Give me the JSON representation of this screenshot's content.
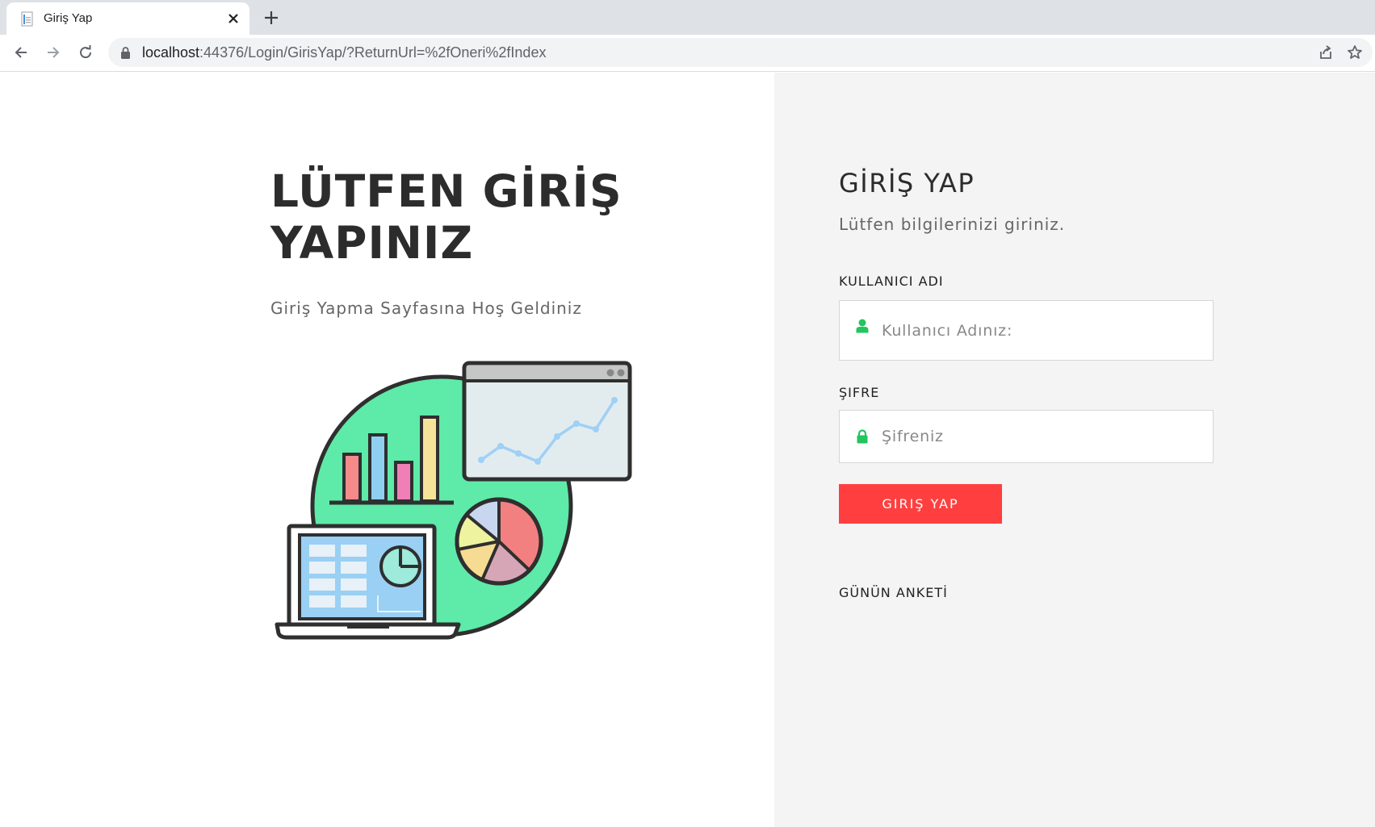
{
  "browser": {
    "tab_title": "Giriş Yap",
    "url_host": "localhost",
    "url_rest": ":44376/Login/GirisYap/?ReturnUrl=%2fOneri%2fIndex"
  },
  "icons": {
    "favicon": "document-icon",
    "tab_close": "close-icon",
    "new_tab": "plus-icon",
    "back": "arrow-left-icon",
    "forward": "arrow-right-icon",
    "reload": "reload-icon",
    "lock": "lock-icon",
    "share": "share-icon",
    "bookmark": "star-icon",
    "username_field": "user-icon",
    "password_field": "lock-icon"
  },
  "hero": {
    "title_line1": "LÜTFEN GİRİŞ",
    "title_line2": "YAPINIZ",
    "subtitle": "Giriş Yapma Sayfasına Hoş Geldiniz"
  },
  "form": {
    "title": "GİRİŞ YAP",
    "subtitle": "Lütfen bilgilerinizi giriniz.",
    "username_label": "KULLANICI ADI",
    "username_placeholder": "Kullanıcı Adınız:",
    "password_label": "ŞIFRE",
    "password_placeholder": "Şifreniz",
    "submit_label": "GIRIŞ YAP",
    "poll_title": "GÜNÜN ANKETİ"
  },
  "colors": {
    "accent": "#ff3f3f",
    "icon_green": "#22c55e",
    "right_panel_bg": "#f4f4f4",
    "illustration_circle": "#5eeaa8"
  }
}
